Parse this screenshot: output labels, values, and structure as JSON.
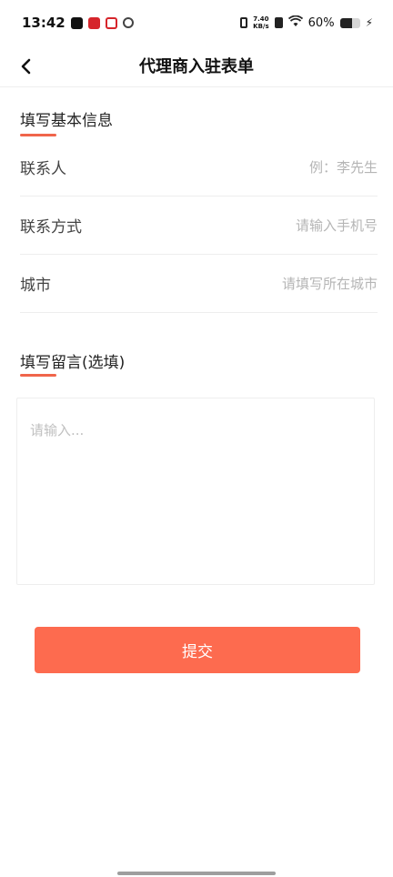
{
  "status_bar": {
    "time": "13:42",
    "net_speed_value": "7.40",
    "net_speed_unit": "KB/s",
    "battery_percent_text": "60%",
    "battery_level": 0.6,
    "icons": [
      "tiktok-icon",
      "app-icon",
      "app-icon",
      "search-icon",
      "vibrate-icon",
      "no-sim-icon",
      "wifi-icon",
      "battery-icon",
      "charging-icon"
    ]
  },
  "nav": {
    "title": "代理商入驻表单",
    "back_icon": "chevron-left-icon"
  },
  "basic_info": {
    "title": "填写基本信息",
    "fields": [
      {
        "label": "联系人",
        "placeholder": "例：李先生",
        "value": ""
      },
      {
        "label": "联系方式",
        "placeholder": "请输入手机号",
        "value": ""
      },
      {
        "label": "城市",
        "placeholder": "请填写所在城市",
        "value": ""
      }
    ]
  },
  "message": {
    "title": "填写留言(选填)",
    "placeholder": "请输入...",
    "value": ""
  },
  "submit": {
    "label": "提交"
  },
  "colors": {
    "accent": "#f0654b",
    "button": "#fd6b4f",
    "divider": "#eeeeee",
    "placeholder": "#b5b5b5"
  }
}
